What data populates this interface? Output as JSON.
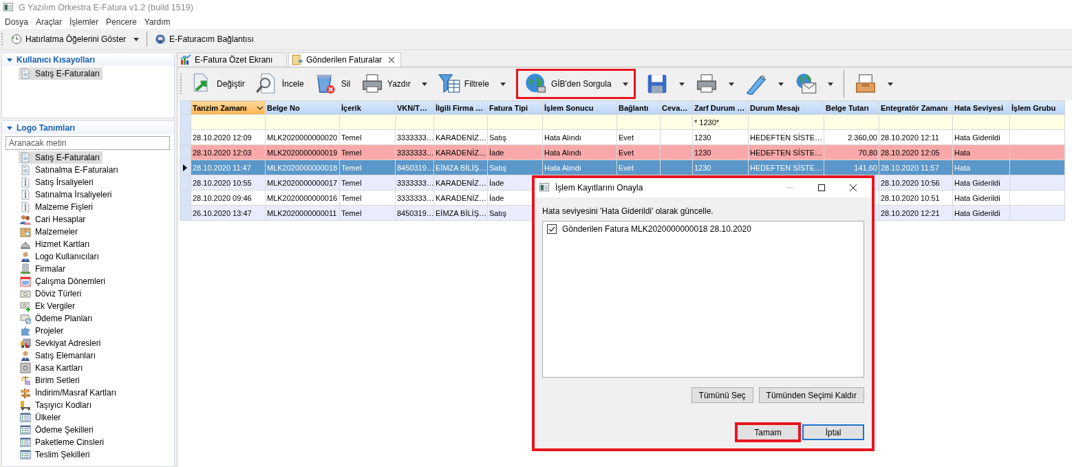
{
  "window": {
    "title": "G Yazılım Orkestra E-Fatura v1.2 (build 1519)"
  },
  "menu": [
    "Dosya",
    "Araçlar",
    "İşlemler",
    "Pencere",
    "Yardım"
  ],
  "main_toolbar": [
    {
      "label": "Hatırlatma Öğelerini Göster",
      "kind": "clock",
      "dropdown": true
    },
    {
      "label": "E-Faturacım Bağlantısı",
      "kind": "monitor",
      "dropdown": false
    }
  ],
  "sidebar": {
    "panels": [
      {
        "title": "Kullanıcı Kısayolları",
        "expanded": true,
        "items": [
          {
            "label": "Satış E-Faturaları",
            "kind": "document",
            "selected": true
          }
        ]
      },
      {
        "title": "Logo Tanımları",
        "expanded": true,
        "search": {
          "placeholder": "Aranacak metin"
        },
        "items": [
          {
            "label": "Satış E-Faturaları",
            "kind": "document",
            "selected": true
          },
          {
            "label": "Satınalma E-Faturaları",
            "kind": "document",
            "selected": false
          },
          {
            "label": "Satış İrsaliyeleri",
            "kind": "info",
            "selected": false
          },
          {
            "label": "Satınalma İrsaliyeleri",
            "kind": "info",
            "selected": false
          },
          {
            "label": "Malzeme Fişleri",
            "kind": "info",
            "selected": false
          },
          {
            "label": "Cari Hesaplar",
            "kind": "people",
            "selected": false
          },
          {
            "label": "Malzemeler",
            "kind": "box",
            "selected": false
          },
          {
            "label": "Hizmet Kartları",
            "kind": "bell",
            "selected": false
          },
          {
            "label": "Logo Kullanıcıları",
            "kind": "person",
            "selected": false
          },
          {
            "label": "Firmalar",
            "kind": "building",
            "selected": false
          },
          {
            "label": "Çalışma Dönemleri",
            "kind": "calendar",
            "selected": false
          },
          {
            "label": "Döviz Türleri",
            "kind": "cash",
            "selected": false
          },
          {
            "label": "Ek Vergiler",
            "kind": "cashplus",
            "selected": false
          },
          {
            "label": "Ödeme Planları",
            "kind": "cashedit",
            "selected": false
          },
          {
            "label": "Projeler",
            "kind": "puzzle",
            "selected": false
          },
          {
            "label": "Sevkiyat Adresleri",
            "kind": "truck",
            "selected": false
          },
          {
            "label": "Satış Elemanları",
            "kind": "person",
            "selected": false
          },
          {
            "label": "Kasa Kartları",
            "kind": "safe",
            "selected": false
          },
          {
            "label": "Birim Setleri",
            "kind": "scale",
            "selected": false
          },
          {
            "label": "İndirim/Masraf Kartları",
            "kind": "sign",
            "selected": false
          },
          {
            "label": "Taşıyıcı Kodları",
            "kind": "trolley",
            "selected": false
          },
          {
            "label": "Ülkeler",
            "kind": "list",
            "selected": false
          },
          {
            "label": "Ödeme Şekilleri",
            "kind": "list",
            "selected": false
          },
          {
            "label": "Paketleme Cinsleri",
            "kind": "list",
            "selected": false
          },
          {
            "label": "Teslim Şekilleri",
            "kind": "list",
            "selected": false
          }
        ]
      }
    ]
  },
  "tabs": [
    {
      "label": "E-Fatura Özet Ekranı",
      "kind": "chart",
      "selected": false,
      "closable": false
    },
    {
      "label": "Gönderilen Faturalar",
      "kind": "envelope",
      "selected": true,
      "closable": true
    }
  ],
  "toolbar": [
    {
      "label": "Değiştir",
      "kind": "edit",
      "dropdown": false,
      "highlighted": false
    },
    {
      "label": "İncele",
      "kind": "inspect",
      "dropdown": false,
      "highlighted": false
    },
    {
      "label": "Sil",
      "kind": "delete",
      "dropdown": false,
      "highlighted": false
    },
    {
      "label": "Yazdır",
      "kind": "printer",
      "dropdown": true,
      "highlighted": false
    },
    {
      "label": "Filtrele",
      "kind": "filter",
      "dropdown": true,
      "highlighted": false
    },
    {
      "label": "GİB'den Sorgula",
      "kind": "globe",
      "dropdown": true,
      "highlighted": true
    },
    {
      "kind": "save",
      "dropdown": true,
      "highlighted": false
    },
    {
      "kind": "printer",
      "dropdown": true,
      "highlighted": false
    },
    {
      "kind": "tag",
      "dropdown": true,
      "highlighted": false
    },
    {
      "kind": "mail",
      "dropdown": true,
      "highlighted": false
    },
    {
      "kind": "separator"
    },
    {
      "kind": "tray",
      "dropdown": true,
      "highlighted": false
    }
  ],
  "table": {
    "columns": [
      {
        "label": "Tanzim Zamanı",
        "sorted": true
      },
      {
        "label": "Belge No",
        "sorted": false
      },
      {
        "label": "İçerik",
        "sorted": false
      },
      {
        "label": "VKN/T…",
        "sorted": false
      },
      {
        "label": "İlgili Firma …",
        "sorted": false
      },
      {
        "label": "Fatura Tipi",
        "sorted": false
      },
      {
        "label": "İşlem Sonucu",
        "sorted": false
      },
      {
        "label": "Bağlantı",
        "sorted": false
      },
      {
        "label": "Ceva…",
        "sorted": false
      },
      {
        "label": "Zarf Durum …",
        "sorted": false
      },
      {
        "label": "Durum Mesajı",
        "sorted": false
      },
      {
        "label": "Belge Tutarı",
        "sorted": false
      },
      {
        "label": "Entegratör Zamanı",
        "sorted": false
      },
      {
        "label": "Hata Seviyesi",
        "sorted": false
      },
      {
        "label": "İşlem Grubu",
        "sorted": false
      }
    ],
    "filter_row": {
      "envelope_status": "* 1230*"
    },
    "rows": [
      {
        "selected": false,
        "error": false,
        "time": "28.10.2020 12:09",
        "doc_no": "MLK2020000000020",
        "content": "Temel",
        "tax_no": "3333333…",
        "company": "KARADENİZ…",
        "invoice_type": "Satış",
        "result": "Hata Alındı",
        "link": "Evet",
        "envelope_status": "1230",
        "status_message": "HEDEFTEN SİSTE…",
        "amount": "2.360,00",
        "integrator_time": "28.10.2020 12:11",
        "error_level": "Hata Giderildi"
      },
      {
        "selected": false,
        "error": true,
        "time": "28.10.2020 12:03",
        "doc_no": "MLK2020000000019",
        "content": "Temel",
        "tax_no": "3333333…",
        "company": "KARADENİZ…",
        "invoice_type": "İade",
        "result": "Hata Alındı",
        "link": "Evet",
        "envelope_status": "1230",
        "status_message": "HEDEFTEN SİSTE…",
        "amount": "70,80",
        "integrator_time": "28.10.2020 12:05",
        "error_level": "Hata"
      },
      {
        "selected": true,
        "error": false,
        "time": "28.10.2020 11:47",
        "doc_no": "MLK2020000000018",
        "content": "Temel",
        "tax_no": "8450319…",
        "company": "EİMZA BİLİŞ…",
        "invoice_type": "Satış",
        "result": "Hata Alındı",
        "link": "Evet",
        "envelope_status": "1230",
        "status_message": "HEDEFTEN SİSTE…",
        "amount": "141,60",
        "integrator_time": "28.10.2020 11:57",
        "error_level": "Hata"
      },
      {
        "selected": false,
        "error": false,
        "time": "28.10.2020 10:55",
        "doc_no": "MLK2020000000017",
        "content": "Temel",
        "tax_no": "3333333…",
        "company": "KARADENİZ…",
        "invoice_type": "İade",
        "integrator_time": "28.10.2020 10:56",
        "error_level": "Hata Giderildi"
      },
      {
        "selected": false,
        "error": false,
        "time": "28.10.2020 09:46",
        "doc_no": "MLK2020000000016",
        "content": "Temel",
        "tax_no": "3333333…",
        "company": "KARADENİZ…",
        "invoice_type": "İade",
        "integrator_time": "28.10.2020 10:51",
        "error_level": "Hata Giderildi"
      },
      {
        "selected": false,
        "error": false,
        "time": "26.10.2020 13:47",
        "doc_no": "MLK2020000000011",
        "content": "Temel",
        "tax_no": "8450319…",
        "company": "EİMZA BİLİŞ…",
        "invoice_type": "Satış",
        "integrator_time": "28.10.2020 12:21",
        "error_level": "Hata Giderildi"
      }
    ]
  },
  "dialog": {
    "title": "İşlem Kayıtlarını Onayla",
    "highlighted": true,
    "message": "Hata seviyesini 'Hata Giderildi' olarak güncelle.",
    "items": [
      {
        "label": "Gönderilen Fatura MLK2020000000018 28.10.2020",
        "checked": true
      }
    ],
    "list_buttons": [
      "Tümünü Seç",
      "Tümünden Seçimi Kaldır"
    ],
    "buttons": [
      {
        "label": "Tamam",
        "highlighted": true,
        "focused": false
      },
      {
        "label": "İptal",
        "highlighted": false,
        "focused": true
      }
    ]
  }
}
